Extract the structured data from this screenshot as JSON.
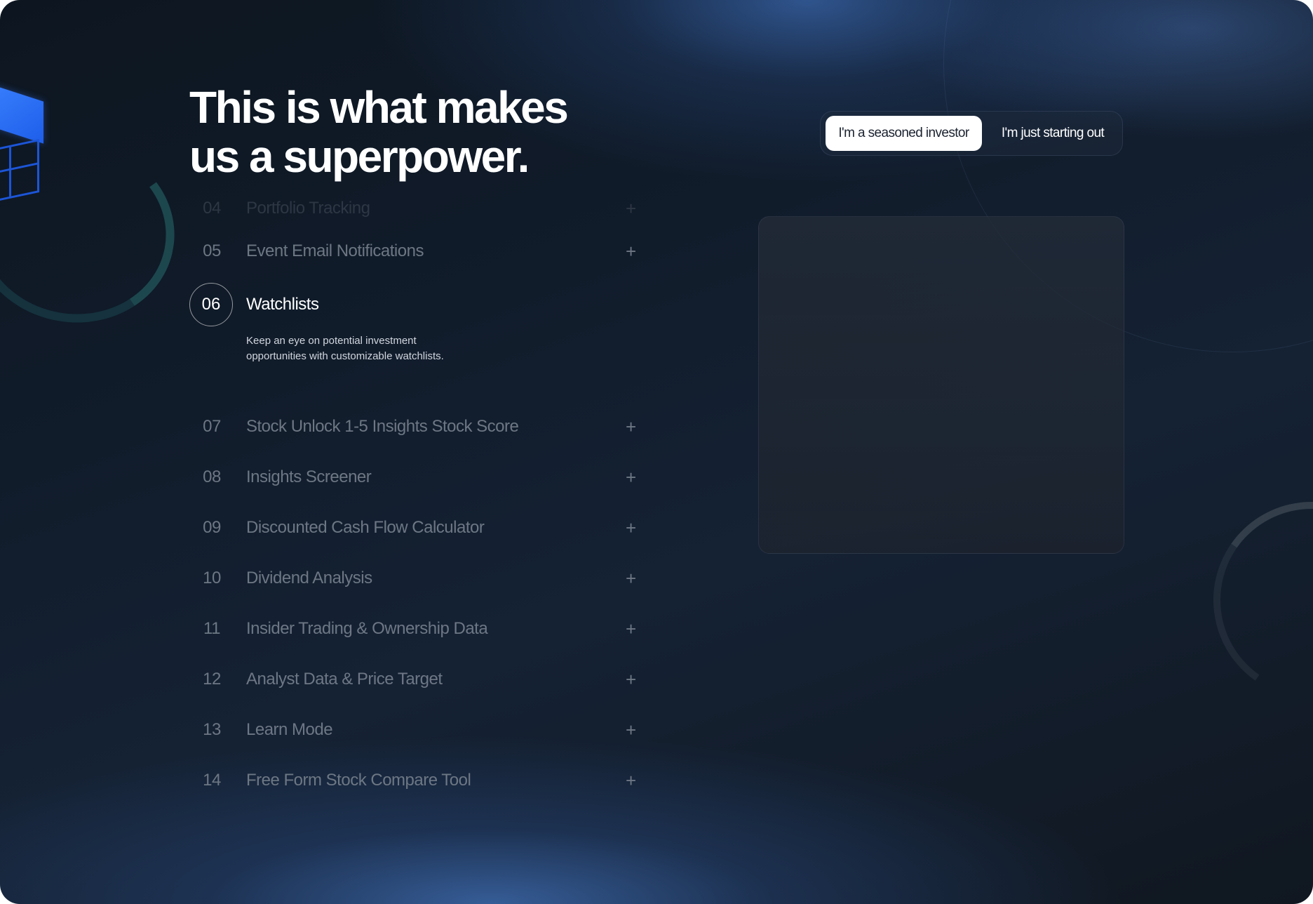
{
  "headline": {
    "line1": "This is what makes",
    "line2": "us a superpower."
  },
  "toggle": {
    "options": [
      {
        "label": "I'm a seasoned investor",
        "selected": true
      },
      {
        "label": "I'm just starting out",
        "selected": false
      }
    ]
  },
  "features": {
    "faded": {
      "num": "04",
      "title": "Portfolio Tracking"
    },
    "before": [
      {
        "num": "05",
        "title": "Event Email Notifications",
        "icon": "plus-icon"
      }
    ],
    "active": {
      "num": "06",
      "title": "Watchlists",
      "description": "Keep an eye on potential investment opportunities with customizable watchlists."
    },
    "after": [
      {
        "num": "07",
        "title": "Stock Unlock 1-5 Insights Stock Score",
        "icon": "plus-icon"
      },
      {
        "num": "08",
        "title": "Insights Screener",
        "icon": "plus-icon"
      },
      {
        "num": "09",
        "title": "Discounted Cash Flow Calculator",
        "icon": "plus-icon"
      },
      {
        "num": "10",
        "title": "Dividend Analysis",
        "icon": "plus-icon"
      },
      {
        "num": "11",
        "title": "Insider Trading & Ownership Data",
        "icon": "plus-icon"
      },
      {
        "num": "12",
        "title": "Analyst Data & Price Target",
        "icon": "plus-icon"
      },
      {
        "num": "13",
        "title": "Learn Mode",
        "icon": "plus-icon"
      },
      {
        "num": "14",
        "title": "Free Form Stock Compare Tool",
        "icon": "plus-icon"
      }
    ],
    "plus_glyph": "+"
  },
  "colors": {
    "background_dark": "#0d1620",
    "accent_blue": "#3b82ff",
    "text_primary": "#ffffff",
    "text_muted": "#6d7784"
  }
}
